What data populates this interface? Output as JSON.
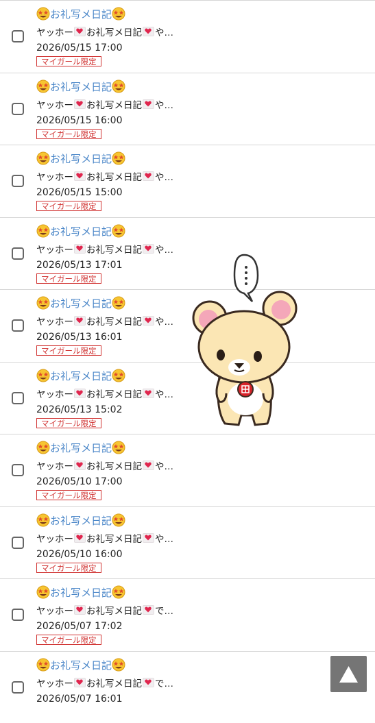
{
  "items": [
    {
      "title": "お礼写メ日記",
      "preview_prefix": "ヤッホー",
      "preview_mid": "お礼写メ日記",
      "preview_suffix": "や…",
      "datetime": "2026/05/15 17:00",
      "badge": "マイガール限定"
    },
    {
      "title": "お礼写メ日記",
      "preview_prefix": "ヤッホー",
      "preview_mid": "お礼写メ日記",
      "preview_suffix": "や…",
      "datetime": "2026/05/15 16:00",
      "badge": "マイガール限定"
    },
    {
      "title": "お礼写メ日記",
      "preview_prefix": "ヤッホー",
      "preview_mid": "お礼写メ日記",
      "preview_suffix": "や…",
      "datetime": "2026/05/15 15:00",
      "badge": "マイガール限定"
    },
    {
      "title": "お礼写メ日記",
      "preview_prefix": "ヤッホー",
      "preview_mid": "お礼写メ日記",
      "preview_suffix": "や…",
      "datetime": "2026/05/13 17:01",
      "badge": "マイガール限定"
    },
    {
      "title": "お礼写メ日記",
      "preview_prefix": "ヤッホー",
      "preview_mid": "お礼写メ日記",
      "preview_suffix": "や…",
      "datetime": "2026/05/13 16:01",
      "badge": "マイガール限定"
    },
    {
      "title": "お礼写メ日記",
      "preview_prefix": "ヤッホー",
      "preview_mid": "お礼写メ日記",
      "preview_suffix": "や…",
      "datetime": "2026/05/13 15:02",
      "badge": "マイガール限定"
    },
    {
      "title": "お礼写メ日記",
      "preview_prefix": "ヤッホー",
      "preview_mid": "お礼写メ日記",
      "preview_suffix": "や…",
      "datetime": "2026/05/10 17:00",
      "badge": "マイガール限定"
    },
    {
      "title": "お礼写メ日記",
      "preview_prefix": "ヤッホー",
      "preview_mid": "お礼写メ日記",
      "preview_suffix": "や…",
      "datetime": "2026/05/10 16:00",
      "badge": "マイガール限定"
    },
    {
      "title": "お礼写メ日記",
      "preview_prefix": "ヤッホー",
      "preview_mid": "お礼写メ日記",
      "preview_suffix": "で…",
      "datetime": "2026/05/07 17:02",
      "badge": "マイガール限定"
    },
    {
      "title": "お礼写メ日記",
      "preview_prefix": "ヤッホー",
      "preview_mid": "お礼写メ日記",
      "preview_suffix": "で…",
      "datetime": "2026/05/07 16:01",
      "badge": ""
    }
  ],
  "icons": {
    "title_emoji": "star-struck-face-icon",
    "preview_emoji": "heart-letter-icon",
    "scroll_top": "triangle-up-icon",
    "sticker": "bear-sticker-icon"
  },
  "colors": {
    "title": "#4a86c8",
    "badge": "#d0302f",
    "scroll_button": "#757575"
  }
}
